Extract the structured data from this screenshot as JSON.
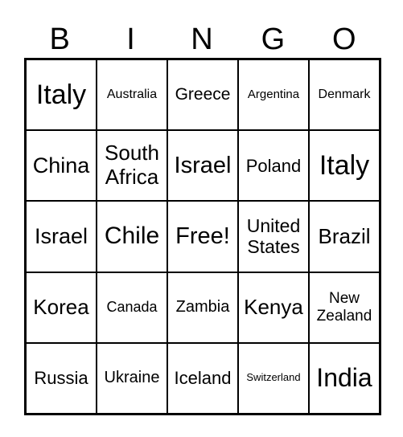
{
  "header": [
    "B",
    "I",
    "N",
    "G",
    "O"
  ],
  "cells": [
    [
      "Italy",
      "Australia",
      "Greece",
      "Argentina",
      "Denmark"
    ],
    [
      "China",
      "South Africa",
      "Israel",
      "Poland",
      "Italy"
    ],
    [
      "Israel",
      "Chile",
      "Free!",
      "United States",
      "Brazil"
    ],
    [
      "Korea",
      "Canada",
      "Zambia",
      "Kenya",
      "New Zealand"
    ],
    [
      "Russia",
      "Ukraine",
      "Iceland",
      "Switzerland",
      "India"
    ]
  ]
}
